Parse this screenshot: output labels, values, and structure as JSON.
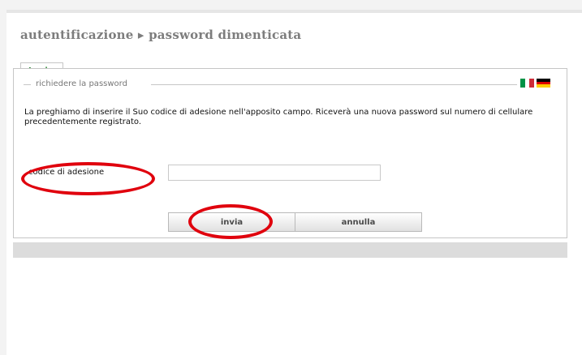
{
  "breadcrumb": "autentificazione ▸ password dimenticata",
  "tabs": [
    {
      "label": "Login"
    }
  ],
  "form": {
    "legend": "richiedere la password",
    "instructions": "La preghiamo di inserire il Suo codice di adesione nell'apposito campo. Riceverà una nuova password sul numero di cellulare precedentemente registrato.",
    "field_label": "codice di adesione",
    "field_value": "",
    "submit_label": "invia",
    "cancel_label": "annulla"
  },
  "languages": [
    {
      "name": "italian-flag",
      "colors": [
        "#009246",
        "#ffffff",
        "#ce2b37"
      ]
    },
    {
      "name": "german-flag",
      "colors": [
        "#000000",
        "#dd0000",
        "#ffce00"
      ]
    }
  ],
  "colors": {
    "tab_text": "#2d8a35",
    "annotation_circle": "#e0000d",
    "title_text": "#7d7d7d"
  }
}
